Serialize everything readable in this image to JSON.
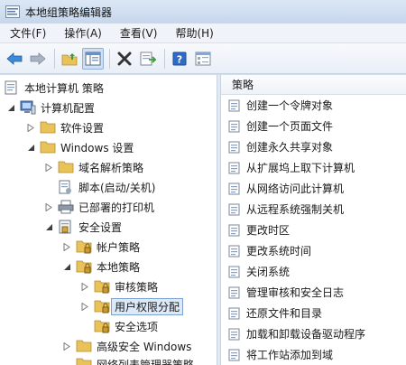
{
  "window": {
    "title": "本地组策略编辑器"
  },
  "menu": [
    "文件(F)",
    "操作(A)",
    "查看(V)",
    "帮助(H)"
  ],
  "toolbar_icons": [
    "back-arrow-icon",
    "forward-arrow-icon",
    "folder-up-icon",
    "show-hide-tree-icon",
    "delete-icon",
    "export-list-icon",
    "help-icon",
    "properties-icon"
  ],
  "tree": {
    "root": "本地计算机 策略",
    "computer_config": "计算机配置",
    "software_settings": "软件设置",
    "windows_settings": "Windows 设置",
    "dns_policy": "域名解析策略",
    "scripts": "脚本(启动/关机)",
    "printers": "已部署的打印机",
    "security_settings": "安全设置",
    "account_policy": "帐户策略",
    "local_policy": "本地策略",
    "audit_policy": "审核策略",
    "user_rights": "用户权限分配",
    "security_options": "安全选项",
    "firewall": "高级安全 Windows",
    "network_list": "网络列表管理器策略"
  },
  "list": {
    "header": "策略",
    "items": [
      "创建一个令牌对象",
      "创建一个页面文件",
      "创建永久共享对象",
      "从扩展坞上取下计算机",
      "从网络访问此计算机",
      "从远程系统强制关机",
      "更改时区",
      "更改系统时间",
      "关闭系统",
      "管理审核和安全日志",
      "还原文件和目录",
      "加载和卸载设备驱动程序",
      "将工作站添加到域"
    ]
  },
  "colors": {
    "folder": "#e9c25a",
    "selection": "#dce9f8",
    "accent": "#3a6ea5"
  }
}
